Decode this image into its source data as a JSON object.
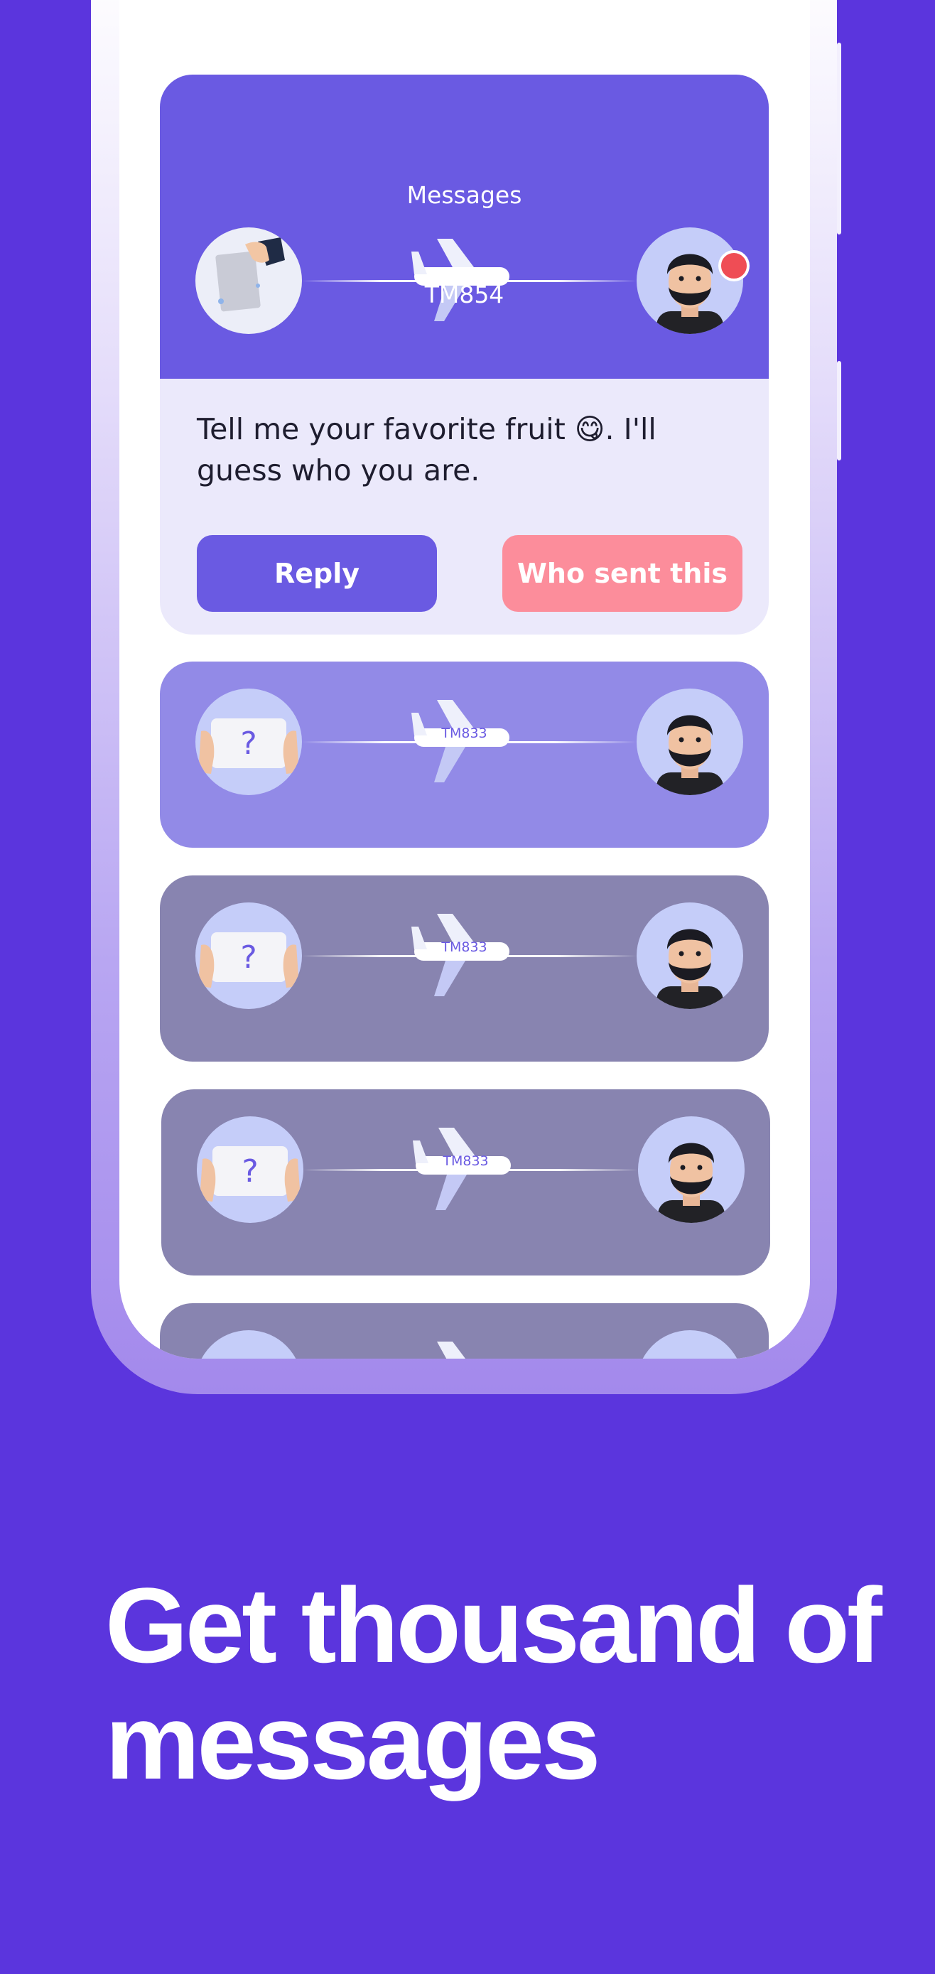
{
  "colors": {
    "background": "#5b35dd",
    "accent": "#6a5ae2",
    "pink_button": "#fc8d9b",
    "notification": "#ef4d55"
  },
  "open_message": {
    "title": "Messages",
    "flight_code": "TM854",
    "text": "Tell me your favorite fruit 😋. I'll guess who you are.",
    "reply_label": "Reply",
    "who_sent_label": "Who sent this",
    "sender_icon": "hand-holding-letter-icon",
    "receiver_icon": "bearded-man-avatar-icon",
    "has_notification": true
  },
  "messages": [
    {
      "flight_code": "TM833",
      "sender_icon": "hands-holding-question-card-icon",
      "receiver_icon": "bearded-man-avatar-icon"
    },
    {
      "flight_code": "TM833",
      "sender_icon": "hands-holding-question-card-icon",
      "receiver_icon": "bearded-man-avatar-icon"
    },
    {
      "flight_code": "TM833",
      "sender_icon": "hands-holding-question-card-icon",
      "receiver_icon": "bearded-man-avatar-icon"
    },
    {
      "flight_code": "",
      "sender_icon": "hands-holding-question-card-icon",
      "receiver_icon": "bearded-man-avatar-icon"
    }
  ],
  "headline": "Get thousand of messages"
}
